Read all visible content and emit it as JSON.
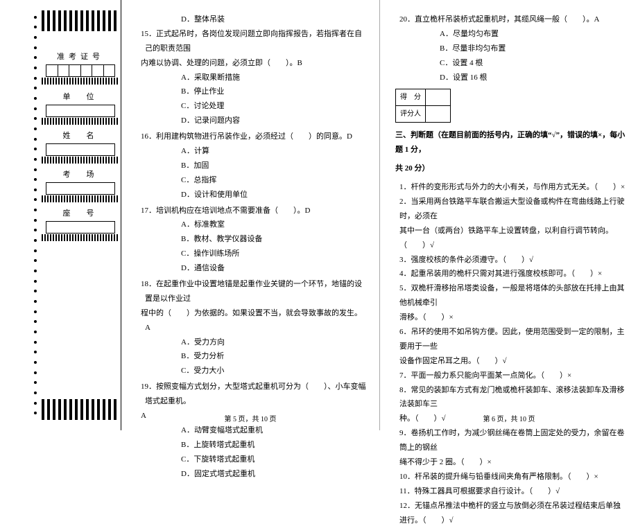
{
  "binding": {
    "label_ticket": "准考证号",
    "label_unit": "单　位",
    "label_name": "姓　名",
    "label_room": "考　场",
    "label_seat": "座　号"
  },
  "left": {
    "q14": {
      "optD": "D．整体吊装"
    },
    "q15": {
      "stem1": "15．正式起吊时，各岗位发现问题立即向指挥报告，若指挥者在自己的职责范围",
      "stem2": "内难以协调、处理的问题，必须立即（　　）。B",
      "optA": "A．采取果断措施",
      "optB": "B．停止作业",
      "optC": "C．讨论处理",
      "optD": "D．记录问题内容"
    },
    "q16": {
      "stem": "16．利用建构筑物进行吊装作业，必须经过（　　）的同意。D",
      "optA": "A．计算",
      "optB": "B．加固",
      "optC": "C．总指挥",
      "optD": "D．设计和使用单位"
    },
    "q17": {
      "stem": "17．培训机构应在培训地点不需要准备（　　）。D",
      "optA": "A．标准教室",
      "optB": "B．教材、教学仪器设备",
      "optC": "C．操作训练场所",
      "optD": "D．通信设备"
    },
    "q18": {
      "stem1": "18．在起重作业中设置地锚是起重作业关键的一个环节，地锚的设置是以作业过",
      "stem2": "程中的（　　）为依据的。如果设置不当，就会导致事故的发生。A",
      "optA": "A．受力方向",
      "optB": "B．受力分析",
      "optC": "C．受力大小"
    },
    "q19": {
      "stem": "19．按照变幅方式划分，大型塔式起重机可分为（　　）、小车变幅塔式起重机。",
      "ans": "A",
      "optA": "A．动臂变幅塔式起重机",
      "optB": "B．上旋转塔式起重机",
      "optC": "C．下旋转塔式起重机",
      "optD": "D．固定式塔式起重机"
    },
    "pager": "第 5 页，共 10 页"
  },
  "right": {
    "q20": {
      "stem": "20．直立桅杆吊装桥式起重机时，其缆风绳一般（　　）。A",
      "optA": "A．尽量均匀布置",
      "optB": "B．尽量非均匀布置",
      "optC": "C．设置 4 根",
      "optD": "D．设置 16 根"
    },
    "score": {
      "row1": "得　分",
      "row2": "评分人"
    },
    "sec3_head1": "三、判断题（在题目前面的括号内，正确的填“√”，错误的填×，每小题 1 分，",
    "sec3_head2": "共 20 分）",
    "j1": "1．杆件的变形形式与外力的大小有关，与作用方式无关。（　　）×",
    "j2a": "2．当采用两台铁路平车联合搬运大型设备或构件在弯曲线路上行驶时，必须在",
    "j2b": "其中一台（或两台）铁路平车上设置转盘，以利自行调节转向。（　　）√",
    "j3": "3．强度校核的条件必须遵守。（　　）√",
    "j4": "4．起重吊装用的桅杆只需对其进行强度校核即可。（　　）×",
    "j5a": "5．双桅杆滑移抬吊塔类设备，一般是将塔体的头部放在托排上由其他机械牵引",
    "j5b": "滑移。（　　）×",
    "j6a": "6．吊环的使用不如吊钩方便。因此，使用范围受到一定的限制，主要用于一些",
    "j6b": "设备作固定吊耳之用。（　　）√",
    "j7": "7．平面一般力系只能向平面某一点简化。（　　）×",
    "j8a": "8．常见的装卸车方式有龙门桅或桅杆装卸车、滚移法装卸车及滑移法装卸车三",
    "j8b": "种。（　　）√",
    "j9a": "9．卷扬机工作时，为减少钢丝绳在卷筒上固定处的受力，余留在卷筒上的钢丝",
    "j9b": "绳不得少于 2 圈。（　　）×",
    "j10": "10．杆吊装的提升绳与铅垂线间夹角有严格限制。（　　）×",
    "j11": "11．特殊工器具可根据要求自行设计。（　　）√",
    "j12": "12．无锚点吊推法中桅杆的竖立与放倒必须在吊装过程结束后单独进行。（　　）√",
    "pager": "第 6 页，共 10 页"
  }
}
